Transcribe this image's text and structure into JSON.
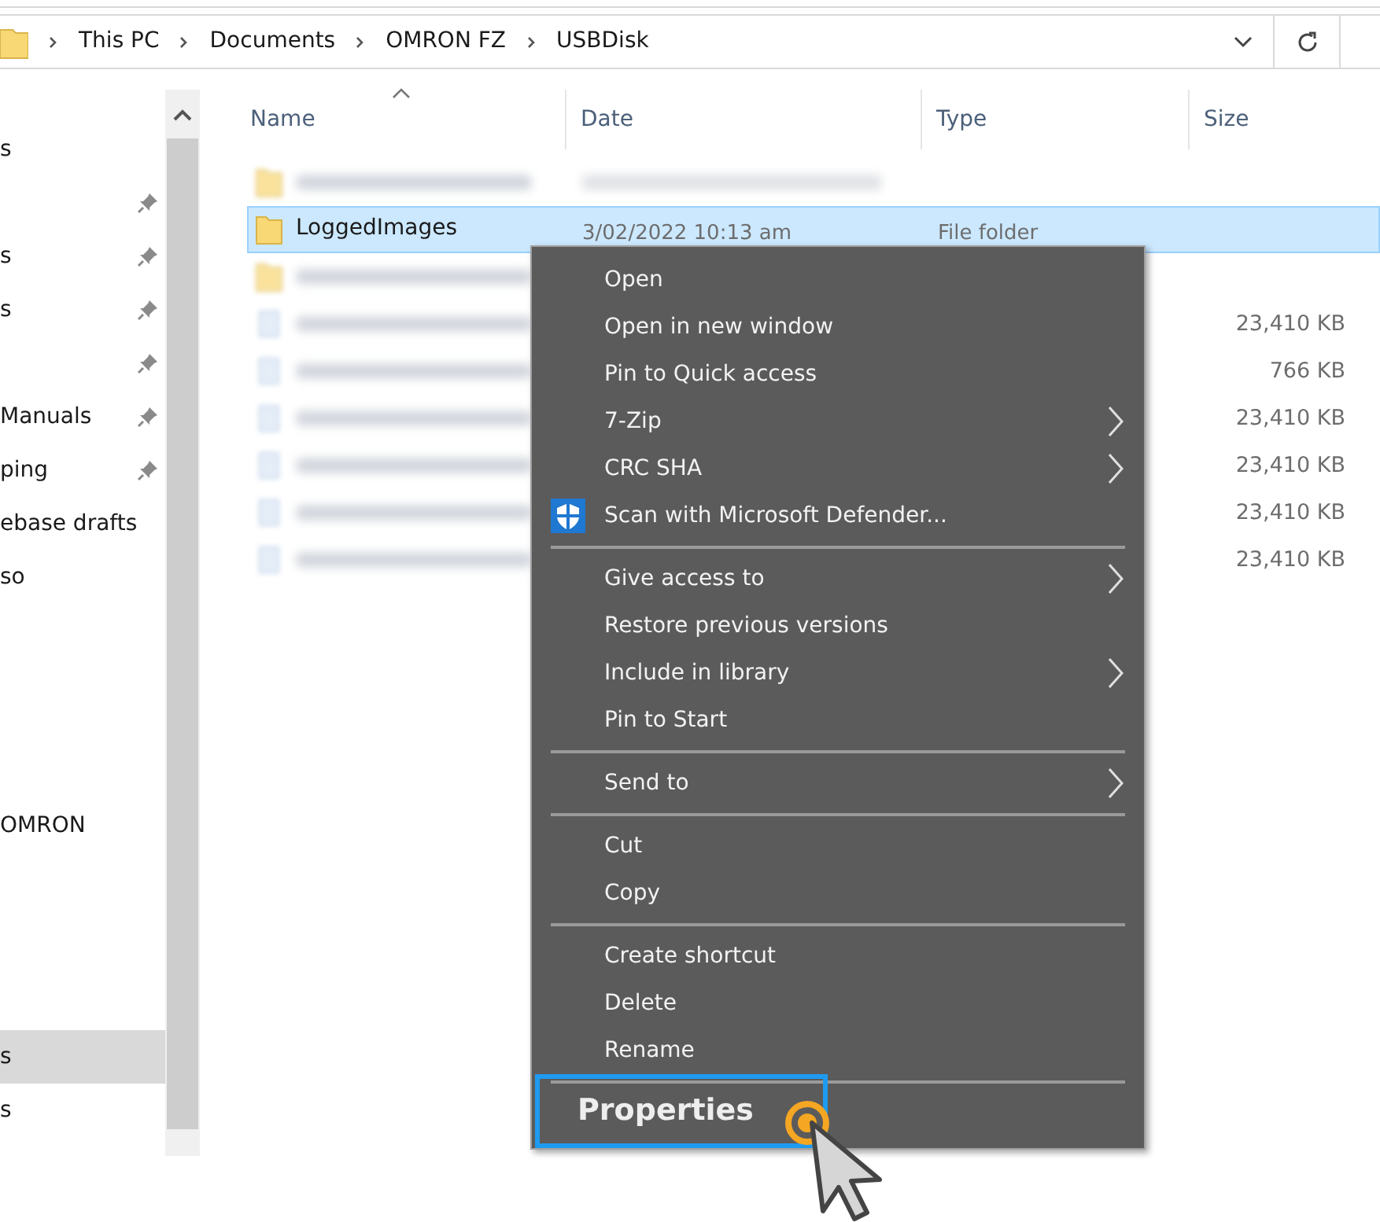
{
  "address_bar": {
    "crumbs": [
      "This PC",
      "Documents",
      "OMRON FZ",
      "USBDisk"
    ]
  },
  "sidebar": {
    "groups": [
      [
        {
          "label": "s",
          "pinned": false,
          "selected": false
        },
        {
          "pinned": true,
          "selected": false
        },
        {
          "label": "s",
          "pinned": true,
          "selected": false
        },
        {
          "label": "s",
          "pinned": true,
          "selected": false
        },
        {
          "pinned": true,
          "selected": false
        },
        {
          "label": "Manuals",
          "pinned": true,
          "selected": false
        },
        {
          "label": "ping",
          "pinned": true,
          "selected": false
        },
        {
          "label": "ebase drafts",
          "pinned": false,
          "selected": false
        },
        {
          "label": "so",
          "pinned": false,
          "selected": false
        }
      ],
      [
        {
          "label": "OMRON",
          "pinned": false,
          "selected": false
        }
      ],
      [
        {
          "label": "s",
          "pinned": false,
          "selected": true
        },
        {
          "label": "s",
          "pinned": false,
          "selected": false
        }
      ]
    ]
  },
  "file_list": {
    "columns": [
      "Name",
      "Date",
      "Type",
      "Size"
    ],
    "rows": [
      {
        "kind": "folder",
        "blurred": true,
        "selected": false
      },
      {
        "kind": "folder",
        "blurred": false,
        "selected": true,
        "name": "LoggedImages",
        "date": "3/02/2022 10:13 am",
        "type": "File folder"
      },
      {
        "kind": "folder",
        "blurred": true,
        "selected": false
      },
      {
        "kind": "file",
        "blurred": true,
        "selected": false,
        "size": "23,410 KB"
      },
      {
        "kind": "file",
        "blurred": true,
        "selected": false,
        "size": "766 KB"
      },
      {
        "kind": "file",
        "blurred": true,
        "selected": false,
        "size": "23,410 KB"
      },
      {
        "kind": "file",
        "blurred": true,
        "selected": false,
        "size": "23,410 KB"
      },
      {
        "kind": "file",
        "blurred": true,
        "selected": false,
        "size": "23,410 KB"
      },
      {
        "kind": "file",
        "blurred": true,
        "selected": false,
        "size": "23,410 KB"
      }
    ]
  },
  "context_menu": {
    "sections": [
      [
        {
          "label": "Open",
          "submenu": false,
          "shield": false,
          "highlighted": false
        },
        {
          "label": "Open in new window",
          "submenu": false,
          "shield": false,
          "highlighted": false
        },
        {
          "label": "Pin to Quick access",
          "submenu": false,
          "shield": false,
          "highlighted": false
        },
        {
          "label": "7-Zip",
          "submenu": true,
          "shield": false,
          "highlighted": false
        },
        {
          "label": "CRC SHA",
          "submenu": true,
          "shield": false,
          "highlighted": false
        },
        {
          "label": "Scan with Microsoft Defender...",
          "submenu": false,
          "shield": true,
          "highlighted": false
        }
      ],
      [
        {
          "label": "Give access to",
          "submenu": true,
          "shield": false,
          "highlighted": false
        },
        {
          "label": "Restore previous versions",
          "submenu": false,
          "shield": false,
          "highlighted": false
        },
        {
          "label": "Include in library",
          "submenu": true,
          "shield": false,
          "highlighted": false
        },
        {
          "label": "Pin to Start",
          "submenu": false,
          "shield": false,
          "highlighted": false
        }
      ],
      [
        {
          "label": "Send to",
          "submenu": true,
          "shield": false,
          "highlighted": false
        }
      ],
      [
        {
          "label": "Cut",
          "submenu": false,
          "shield": false,
          "highlighted": false
        },
        {
          "label": "Copy",
          "submenu": false,
          "shield": false,
          "highlighted": false
        }
      ],
      [
        {
          "label": "Create shortcut",
          "submenu": false,
          "shield": false,
          "highlighted": false
        },
        {
          "label": "Delete",
          "submenu": false,
          "shield": false,
          "highlighted": false
        },
        {
          "label": "Rename",
          "submenu": false,
          "shield": false,
          "highlighted": false
        }
      ],
      [
        {
          "label": "Properties",
          "submenu": false,
          "shield": false,
          "highlighted": true
        }
      ]
    ]
  }
}
